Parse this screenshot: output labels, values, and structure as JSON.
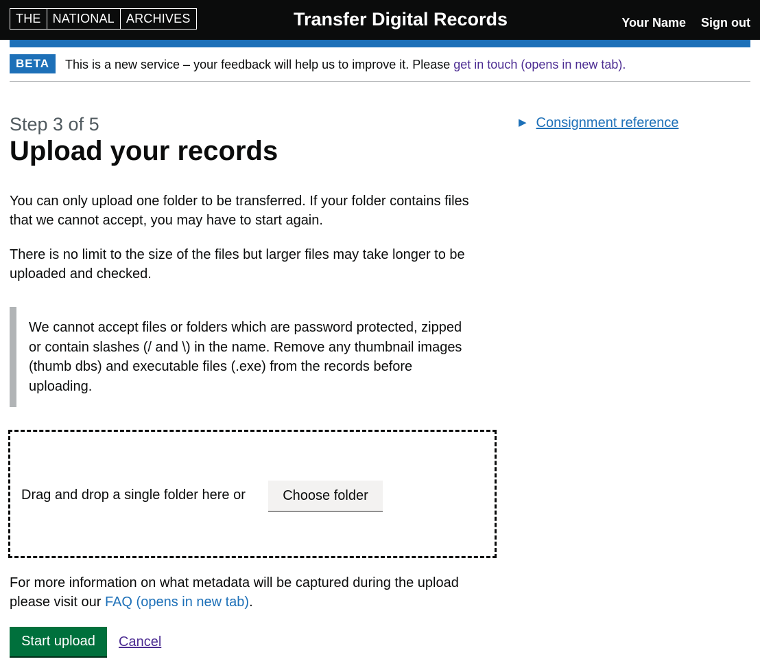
{
  "header": {
    "logo_parts": [
      "THE",
      "NATIONAL",
      "ARCHIVES"
    ],
    "service_name": "Transfer Digital Records",
    "user_name": "Your Name",
    "sign_out": "Sign out"
  },
  "phase_banner": {
    "tag": "BETA",
    "text": "This is a new service – your feedback will help us to improve it. Please ",
    "link": "get in touch (opens in new tab)."
  },
  "main": {
    "caption": "Step 3 of 5",
    "title": "Upload your records",
    "details_summary": "Consignment reference",
    "paragraph1": "You can only upload one folder to be transferred. If your folder contains files that we cannot accept, you may have to start again.",
    "paragraph2": "There is no limit to the size of the files but larger files may take longer to be uploaded and checked.",
    "inset": "We cannot accept files or folders which are password protected, zipped or contain slashes (/ and \\) in the name. Remove any thumbnail images (thumb dbs) and executable files (.exe) from the records before uploading.",
    "dropzone_text": "Drag and drop a single folder here or",
    "choose_button": "Choose folder",
    "metadata_text": "For more information on what metadata will be captured during the upload please visit our ",
    "faq_link": "FAQ (opens in new tab)",
    "metadata_end": ".",
    "start_button": "Start upload",
    "cancel_link": "Cancel"
  },
  "colors": {
    "header_bg": "#0b0c0c",
    "brand_blue": "#1d70b8",
    "visited_link": "#4c2c92",
    "start_green": "#00703c"
  }
}
